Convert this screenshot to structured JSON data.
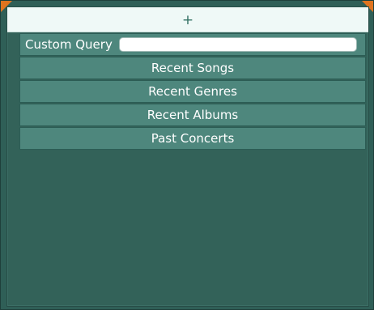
{
  "toolbar": {
    "add_glyph": "+"
  },
  "custom_query": {
    "label": "Custom Query",
    "value": "",
    "placeholder": ""
  },
  "queries": [
    {
      "label": "Recent Songs"
    },
    {
      "label": "Recent Genres"
    },
    {
      "label": "Recent Albums"
    },
    {
      "label": "Past Concerts"
    }
  ],
  "colors": {
    "accent_corner": "#e0741f",
    "row_bg": "#4e877d",
    "panel_bg": "#336259",
    "add_bar_bg": "#eff9f7"
  }
}
